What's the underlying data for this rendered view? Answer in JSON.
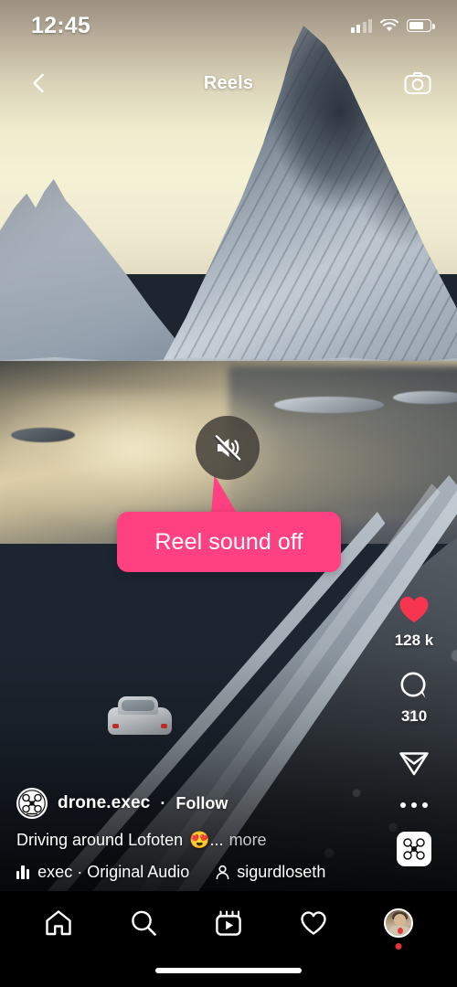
{
  "status_bar": {
    "time": "12:45",
    "signal_icon": "cellular-bars-icon",
    "wifi_icon": "wifi-icon",
    "battery_icon": "battery-icon"
  },
  "header": {
    "back_icon": "chevron-left-icon",
    "title": "Reels",
    "camera_icon": "camera-icon"
  },
  "overlay": {
    "mute_icon": "speaker-muted-icon",
    "callout_text": "Reel sound off",
    "callout_color": "#ff4081"
  },
  "actions": {
    "like": {
      "icon": "heart-filled-icon",
      "count": "128 k",
      "color": "#f8354f"
    },
    "comment": {
      "icon": "comment-bubble-icon",
      "count": "310"
    },
    "share": {
      "icon": "paper-plane-icon"
    },
    "more": {
      "icon": "more-dots-icon"
    },
    "audio_thumb": {
      "icon": "drone-exec-logo-icon"
    }
  },
  "post": {
    "avatar_icon": "drone-exec-avatar-icon",
    "username": "drone.exec",
    "separator": "·",
    "follow_label": "Follow",
    "caption_text": "Driving around Lofoten",
    "caption_emoji": "😍",
    "caption_ellipsis": "...",
    "more_label": "more",
    "audio_icon": "audio-equalizer-icon",
    "audio_faded": "",
    "audio_label": "exec · Original Audio",
    "collab_icon": "person-icon",
    "collab_name": "sigurdloseth"
  },
  "nav": {
    "items": [
      {
        "name": "home",
        "icon": "home-icon"
      },
      {
        "name": "search",
        "icon": "search-icon"
      },
      {
        "name": "reels",
        "icon": "reels-icon"
      },
      {
        "name": "activity",
        "icon": "heart-outline-icon"
      },
      {
        "name": "profile",
        "icon": "profile-avatar-icon"
      }
    ]
  }
}
